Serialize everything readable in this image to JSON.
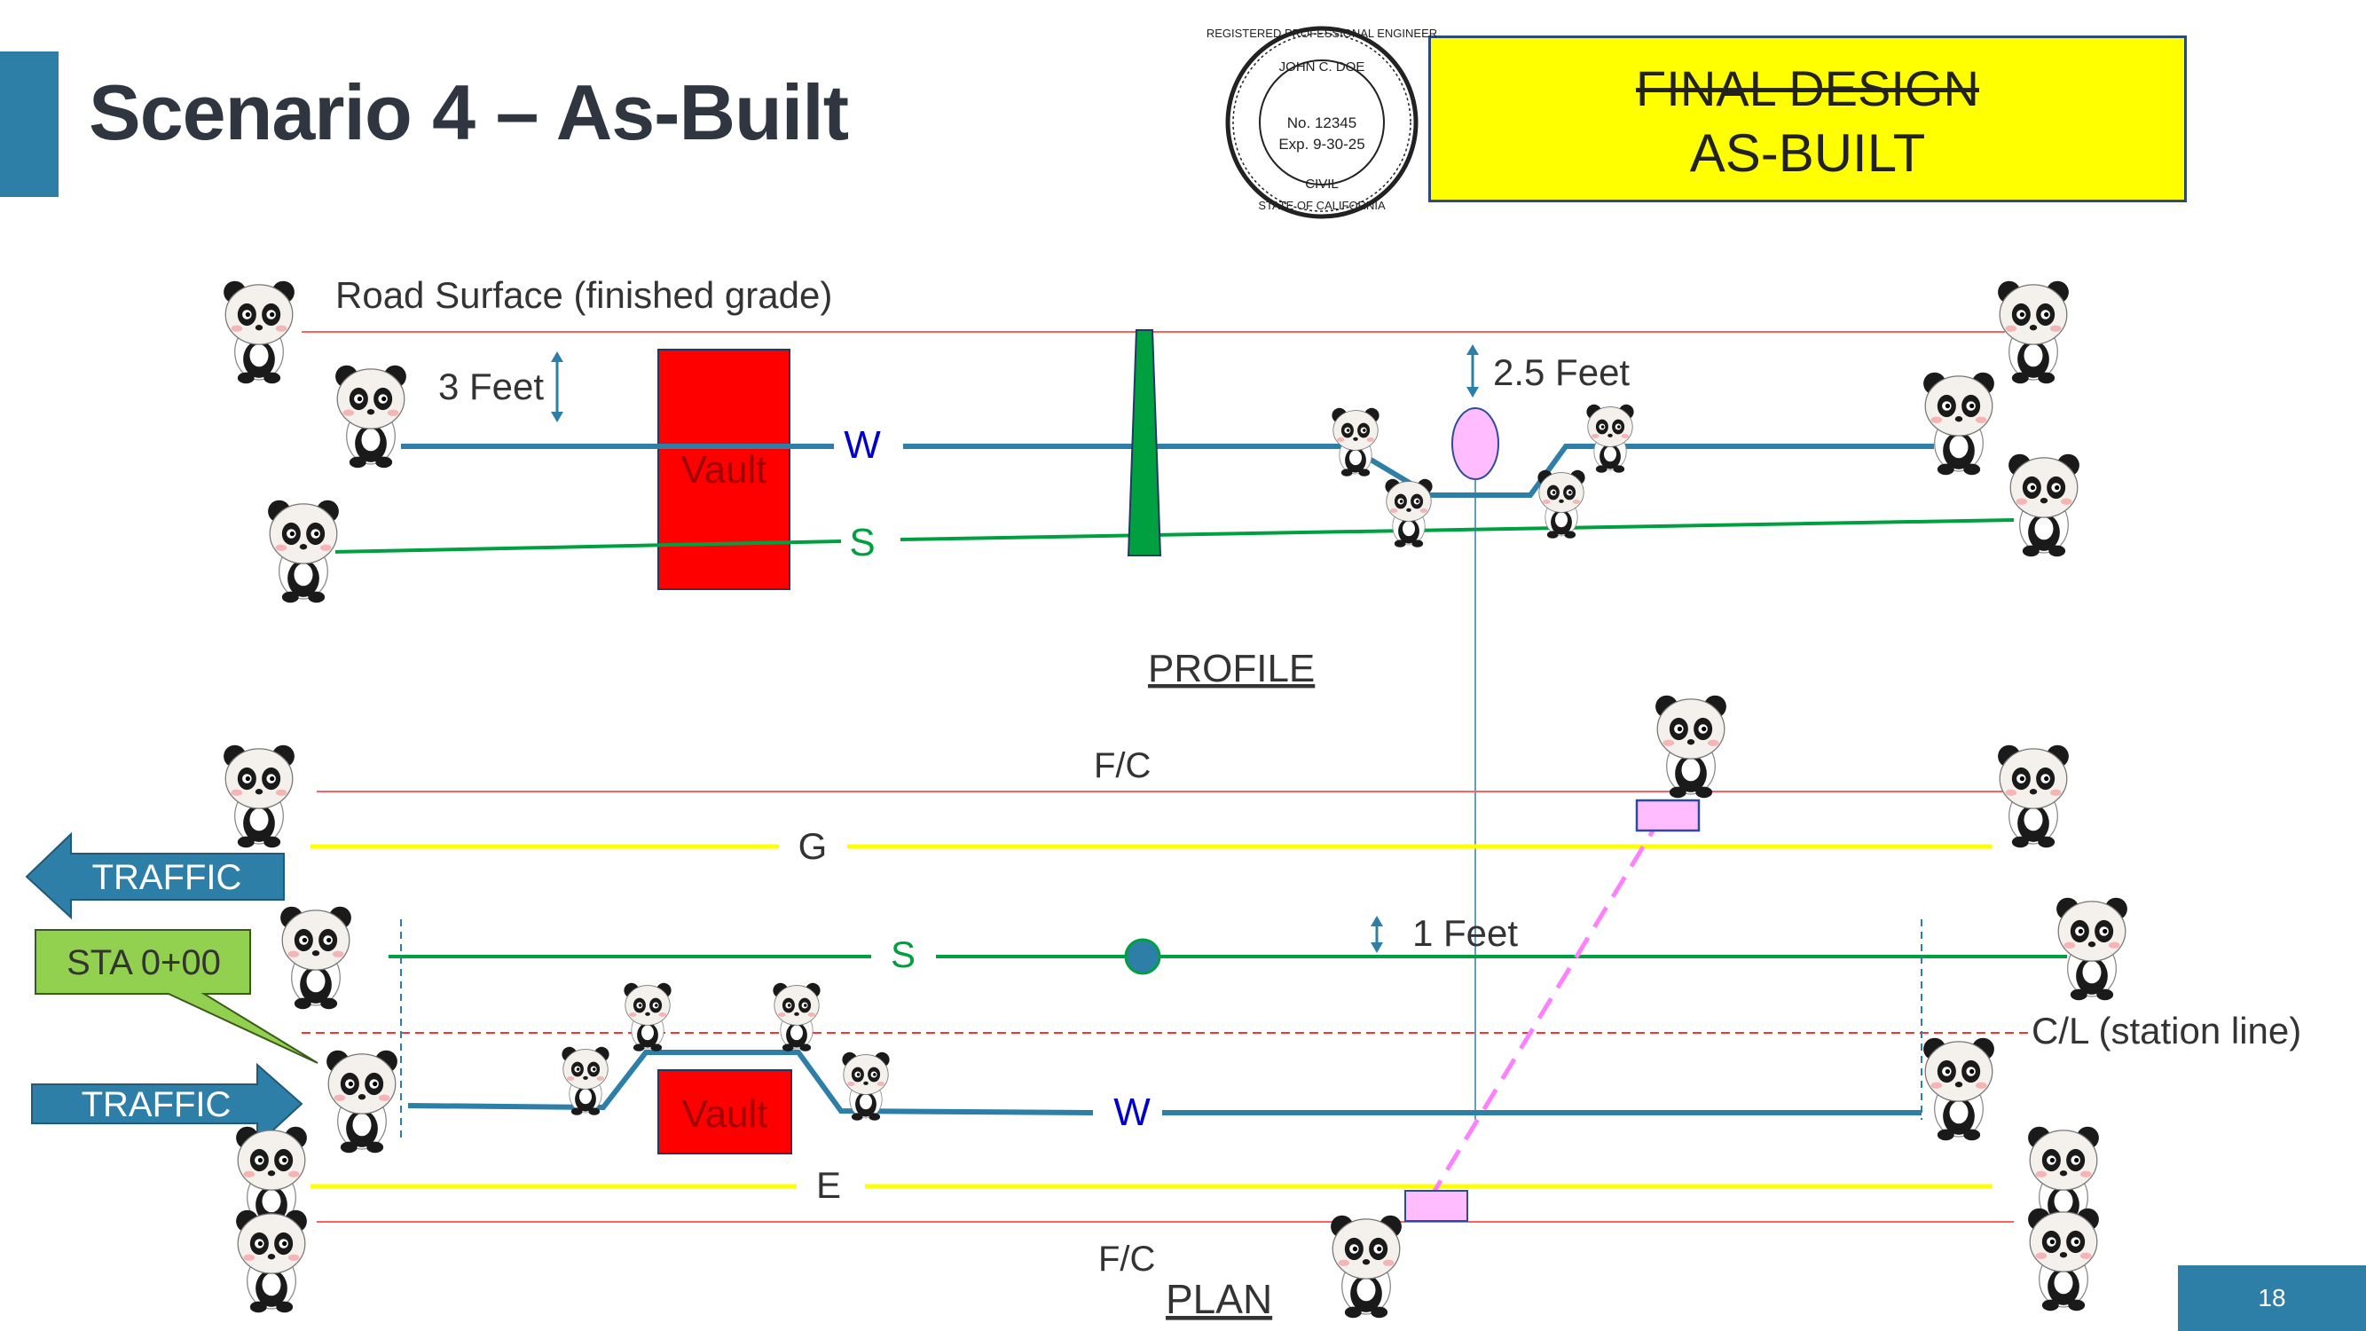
{
  "slide": {
    "title": "Scenario 4 – As-Built",
    "page_number": "18"
  },
  "status_box": {
    "struck_text": "FINAL DESIGN",
    "current_text": "AS-BUILT",
    "color": "#ffff00"
  },
  "seal": {
    "top_text": "REGISTERED PROFESSIONAL ENGINEER",
    "name": "JOHN C. DOE",
    "number": "No. 12345",
    "expiration": "Exp. 9-30-25",
    "discipline": "CIVIL",
    "state": "STATE OF CALIFORNIA"
  },
  "profile": {
    "road_surface_label": "Road Surface (finished grade)",
    "depth_label": "3 Feet",
    "clearance_label": "2.5 Feet",
    "vault_label": "Vault",
    "water_label": "W",
    "sewer_label": "S",
    "section_label": "PROFILE"
  },
  "plan": {
    "top_fc_label": "F/C",
    "bottom_fc_label": "F/C",
    "gas_label": "G",
    "sewer_label": "S",
    "water_label": "W",
    "electric_label": "E",
    "vault_label": "Vault",
    "offset_label": "1 Feet",
    "centerline_label": "C/L (station line)",
    "section_label": "PLAN",
    "traffic_left_label": "TRAFFIC",
    "traffic_right_label": "TRAFFIC",
    "station_label": "STA 0+00"
  },
  "colors": {
    "water": "#2e7fa8",
    "sewer": "#00a040",
    "road": "#ff6060",
    "gas_electric": "#ffff00",
    "vault": "#ff0000",
    "arrow": "#2e7fa8",
    "station_callout": "#92d050",
    "crossing": "#ffbcff"
  },
  "icons": {
    "panda_marker": "panda-icon",
    "arrow_left": "arrow-left-icon",
    "arrow_right": "arrow-right-icon"
  }
}
